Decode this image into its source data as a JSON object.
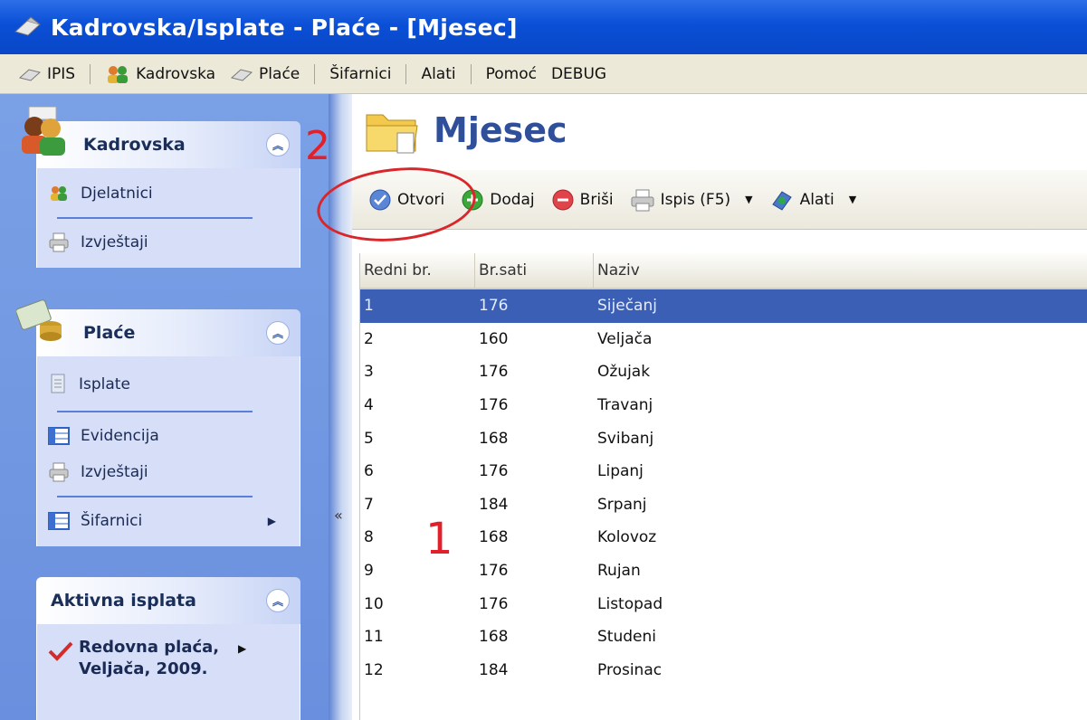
{
  "window": {
    "title": "Kadrovska/Isplate - Plaće - [Mjesec]"
  },
  "menu": {
    "items": [
      "IPIS",
      "Kadrovska",
      "Plaće",
      "Šifarnici",
      "Alati",
      "Pomoć",
      "DEBUG"
    ]
  },
  "sidebar": {
    "kadrovska": {
      "title": "Kadrovska",
      "items": [
        "Djelatnici",
        "Izvještaji"
      ]
    },
    "place": {
      "title": "Plaće",
      "items": [
        "Isplate",
        "Evidencija",
        "Izvještaji",
        "Šifarnici"
      ]
    },
    "aktivna": {
      "title": "Aktivna isplata",
      "value": "Redovna plaća, Veljača, 2009."
    }
  },
  "main": {
    "title": "Mjesec",
    "toolbar": {
      "open": "Otvori",
      "add": "Dodaj",
      "delete": "Briši",
      "print": "Ispis (F5)",
      "tools": "Alati"
    },
    "columns": [
      "Redni br.",
      "Br.sati",
      "Naziv"
    ],
    "rows": [
      [
        "1",
        "176",
        "Siječanj"
      ],
      [
        "2",
        "160",
        "Veljača"
      ],
      [
        "3",
        "176",
        "Ožujak"
      ],
      [
        "4",
        "176",
        "Travanj"
      ],
      [
        "5",
        "168",
        "Svibanj"
      ],
      [
        "6",
        "176",
        "Lipanj"
      ],
      [
        "7",
        "184",
        "Srpanj"
      ],
      [
        "8",
        "168",
        "Kolovoz"
      ],
      [
        "9",
        "176",
        "Rujan"
      ],
      [
        "10",
        "176",
        "Listopad"
      ],
      [
        "11",
        "168",
        "Studeni"
      ],
      [
        "12",
        "184",
        "Prosinac"
      ]
    ],
    "selected_row": 0
  },
  "annotations": {
    "one": "1",
    "two": "2"
  },
  "colors": {
    "titlebar": "#0a4fd6",
    "selection": "#3a5fb5",
    "annotation": "#e0202a"
  }
}
